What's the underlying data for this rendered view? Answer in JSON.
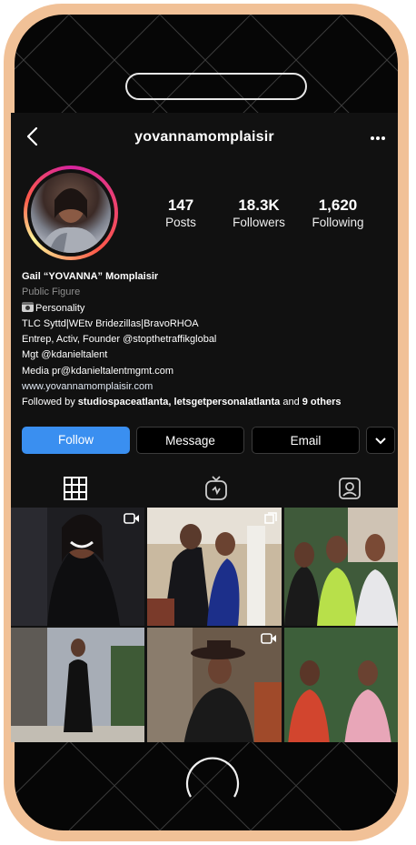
{
  "header": {
    "username": "yovannamomplaisir",
    "back_icon": "chevron-left-icon",
    "more_icon": "more-horizontal-icon"
  },
  "stats": [
    {
      "value": "147",
      "label": "Posts"
    },
    {
      "value": "18.3K",
      "label": "Followers"
    },
    {
      "value": "1,620",
      "label": "Following"
    }
  ],
  "bio": {
    "name": "Gail “YOVANNA” Momplaisir",
    "category": "Public Figure",
    "line1": "Personality",
    "line1_icon": "camera-emoji-icon",
    "line2": "TLC Syttd|WEtv Bridezillas|BravoRHOA",
    "line3": "Entrep, Activ, Founder @stopthetraffikglobal",
    "line4": "Mgt @kdanieltalent",
    "line5": "Media pr@kdanieltalentmgmt.com",
    "website": "www.yovannamomplaisir.com",
    "followed_prefix": "Followed by ",
    "followed_names": "studiospaceatlanta, letsgetpersonalatlanta",
    "followed_and": " and ",
    "followed_others": "9 others"
  },
  "buttons": {
    "follow": "Follow",
    "message": "Message",
    "email": "Email",
    "dropdown_icon": "chevron-down-icon"
  },
  "tabs": [
    "grid-icon",
    "igtv-icon",
    "tagged-icon"
  ],
  "colors": {
    "follow_button": "#3a8ff0",
    "phone_frame": "#f1c197",
    "screen_bg": "#111111"
  }
}
